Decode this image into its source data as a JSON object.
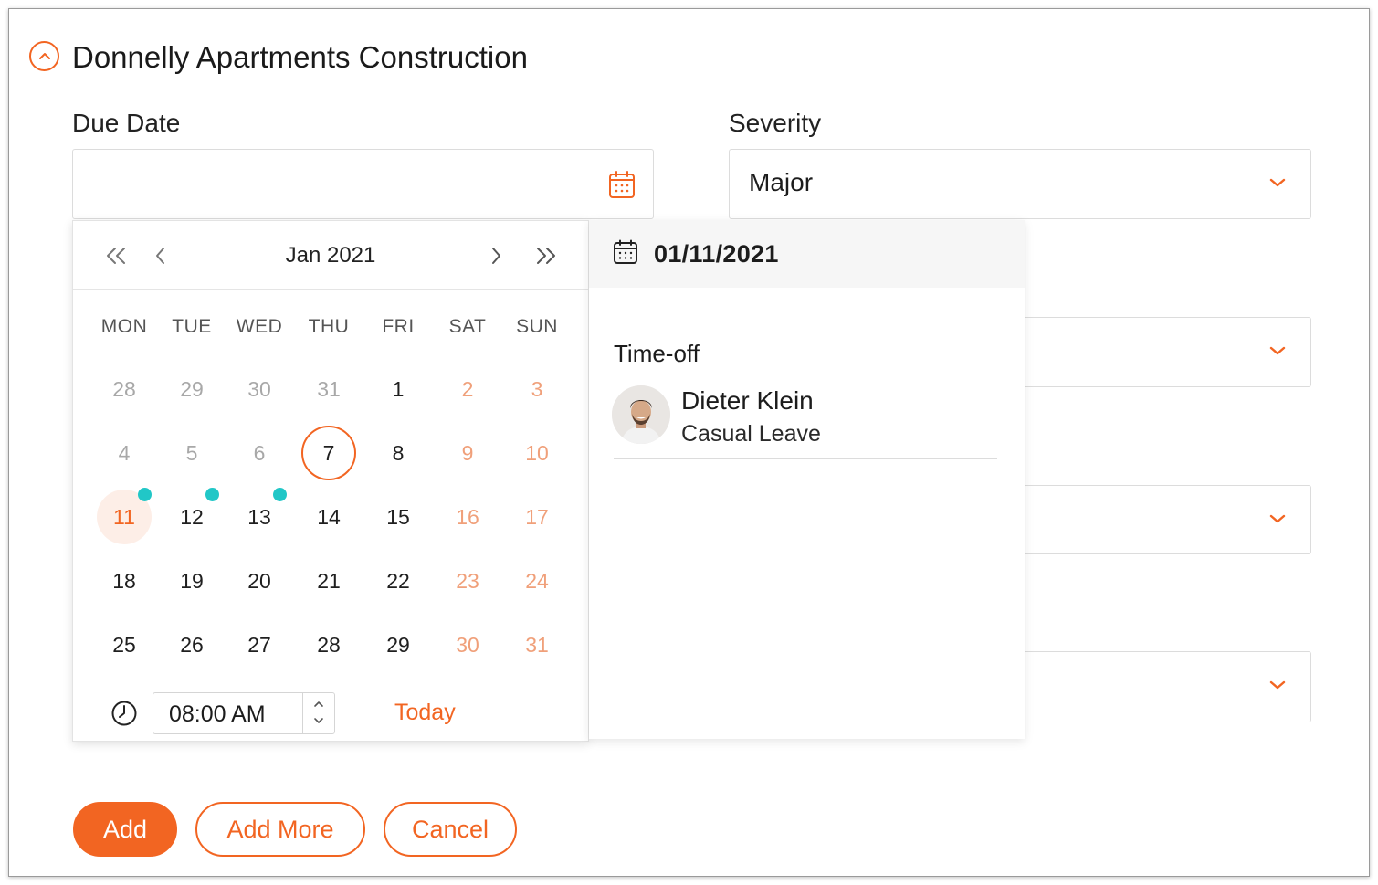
{
  "section": {
    "title": "Donnelly Apartments Construction"
  },
  "due_date": {
    "label": "Due Date",
    "value": ""
  },
  "severity": {
    "label": "Severity",
    "value": "Major"
  },
  "calendar": {
    "month_label": "Jan 2021",
    "weekdays": [
      "MON",
      "TUE",
      "WED",
      "THU",
      "FRI",
      "SAT",
      "SUN"
    ],
    "weeks": [
      [
        "28",
        "29",
        "30",
        "31",
        "1",
        "2",
        "3"
      ],
      [
        "4",
        "5",
        "6",
        "7",
        "8",
        "9",
        "10"
      ],
      [
        "11",
        "12",
        "13",
        "14",
        "15",
        "16",
        "17"
      ],
      [
        "18",
        "19",
        "20",
        "21",
        "22",
        "23",
        "24"
      ],
      [
        "25",
        "26",
        "27",
        "28",
        "29",
        "30",
        "31"
      ]
    ],
    "selected_day": "7",
    "today_day": "11",
    "event_days": [
      "11",
      "12",
      "13"
    ],
    "time_value": "08:00 AM",
    "today_label": "Today"
  },
  "detail": {
    "date": "01/11/2021",
    "section_title": "Time-off",
    "person": {
      "name": "Dieter Klein",
      "leave_type": "Casual Leave"
    }
  },
  "buttons": {
    "add": "Add",
    "add_more": "Add More",
    "cancel": "Cancel"
  },
  "colors": {
    "accent": "#f26522",
    "event_dot": "#21c7c7",
    "today_bg": "#fdeee7"
  }
}
